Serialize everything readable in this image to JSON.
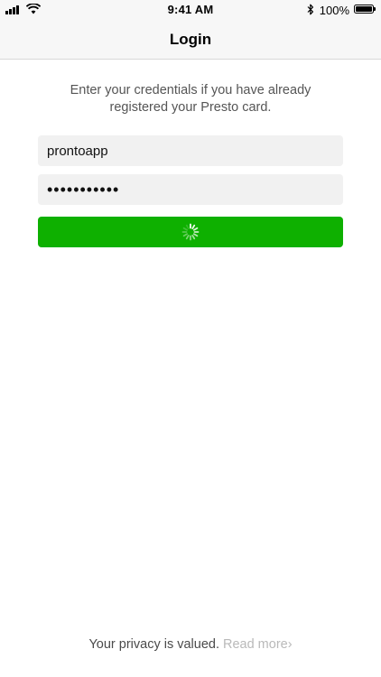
{
  "status_bar": {
    "time": "9:41 AM",
    "battery_percent": "100%",
    "battery_level": 1.0
  },
  "nav": {
    "title": "Login"
  },
  "intro": {
    "line1": "Enter your credentials if you have already",
    "line2": "registered your Presto card."
  },
  "form": {
    "username_value": "prontoapp",
    "password_value": "•••••••••••",
    "submit_state": "loading"
  },
  "footer": {
    "privacy_text": "Your privacy is valued.",
    "read_more_label": "Read more›"
  },
  "colors": {
    "accent_green": "#0eb000",
    "input_bg": "#f1f1f1",
    "muted_text": "#b9b9b9"
  }
}
